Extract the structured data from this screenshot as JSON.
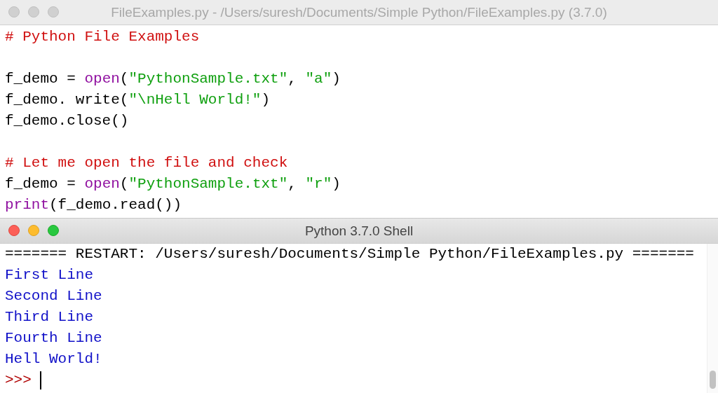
{
  "editor": {
    "title": "FileExamples.py - /Users/suresh/Documents/Simple Python/FileExamples.py (3.7.0)",
    "active": false,
    "blocks": [
      [
        [
          {
            "kind": "comment",
            "text": "# Python File Examples"
          }
        ]
      ],
      [
        [
          {
            "kind": "plain",
            "text": "f_demo = "
          },
          {
            "kind": "builtin",
            "text": "open"
          },
          {
            "kind": "plain",
            "text": "("
          },
          {
            "kind": "string",
            "text": "\"PythonSample.txt\""
          },
          {
            "kind": "plain",
            "text": ", "
          },
          {
            "kind": "string",
            "text": "\"a\""
          },
          {
            "kind": "plain",
            "text": ")"
          }
        ],
        [
          {
            "kind": "plain",
            "text": "f_demo. write("
          },
          {
            "kind": "string",
            "text": "\"\\nHell World!\""
          },
          {
            "kind": "plain",
            "text": ")"
          }
        ],
        [
          {
            "kind": "plain",
            "text": "f_demo.close()"
          }
        ]
      ],
      [
        [
          {
            "kind": "comment",
            "text": "# Let me open the file and check"
          }
        ],
        [
          {
            "kind": "plain",
            "text": "f_demo = "
          },
          {
            "kind": "builtin",
            "text": "open"
          },
          {
            "kind": "plain",
            "text": "("
          },
          {
            "kind": "string",
            "text": "\"PythonSample.txt\""
          },
          {
            "kind": "plain",
            "text": ", "
          },
          {
            "kind": "string",
            "text": "\"r\""
          },
          {
            "kind": "plain",
            "text": ")"
          }
        ],
        [
          {
            "kind": "builtin",
            "text": "print"
          },
          {
            "kind": "plain",
            "text": "(f_demo.read())"
          }
        ]
      ]
    ]
  },
  "shell": {
    "title": "Python 3.7.0 Shell",
    "active": true,
    "lines": [
      {
        "kind": "restart",
        "text": "======= RESTART: /Users/suresh/Documents/Simple Python/FileExamples.py ======="
      },
      {
        "kind": "output",
        "text": "First Line"
      },
      {
        "kind": "output",
        "text": "Second Line"
      },
      {
        "kind": "output",
        "text": "Third Line"
      },
      {
        "kind": "output",
        "text": "Fourth Line"
      },
      {
        "kind": "output",
        "text": "Hell World!"
      }
    ],
    "prompt": ">>>"
  }
}
